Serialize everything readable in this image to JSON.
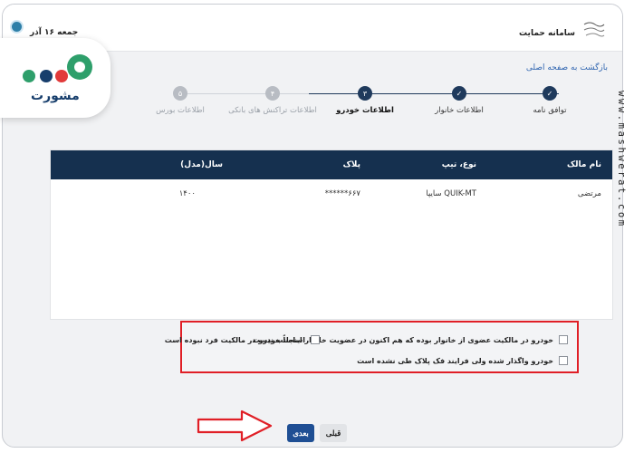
{
  "header": {
    "date": "جمعه ۱۶ آذر",
    "app_name": "سامانه حمایت"
  },
  "back_link": "بازگشت به صفحه اصلی",
  "steps": [
    {
      "number": "",
      "label": "توافق نامه",
      "state": "done"
    },
    {
      "number": "",
      "label": "اطلاعات خانوار",
      "state": "done"
    },
    {
      "number": "۳",
      "label": "اطلاعات خودرو",
      "state": "active"
    },
    {
      "number": "۴",
      "label": "اطلاعات تراکنش های بانکی",
      "state": "pending"
    },
    {
      "number": "۵",
      "label": "اطلاعات بورس",
      "state": "pending"
    }
  ],
  "table": {
    "columns": [
      "نام مالک",
      "نوع، تیپ",
      "پلاک",
      "سال(مدل)"
    ],
    "rows": [
      [
        "مرتضی",
        "QUIK-MT سایپا",
        "۶۶۷******",
        "۱۴۰۰"
      ]
    ]
  },
  "options": {
    "opt1": "خودرو در مالکیت عضوی از خانوار بوده که هم اکنون در عضویت خانوار اینجانب نیست",
    "opt2": "اساساً خودرو در مالکیت فرد نبوده است",
    "opt3": "خودرو واگذار شده ولی فرایند فک پلاک طی نشده است"
  },
  "buttons": {
    "next": "بعدی",
    "prev": "قبلی"
  },
  "logo": {
    "text": "مشورت",
    "colors": {
      "blue": "#173e6c",
      "green": "#2e9f6b",
      "red": "#e23a3a"
    }
  },
  "watermark": "www.mashwerat.com",
  "colors": {
    "table_header": "#15304f",
    "primary_button": "#1f4f94",
    "highlight": "#e01f26",
    "link": "#3267b1"
  }
}
